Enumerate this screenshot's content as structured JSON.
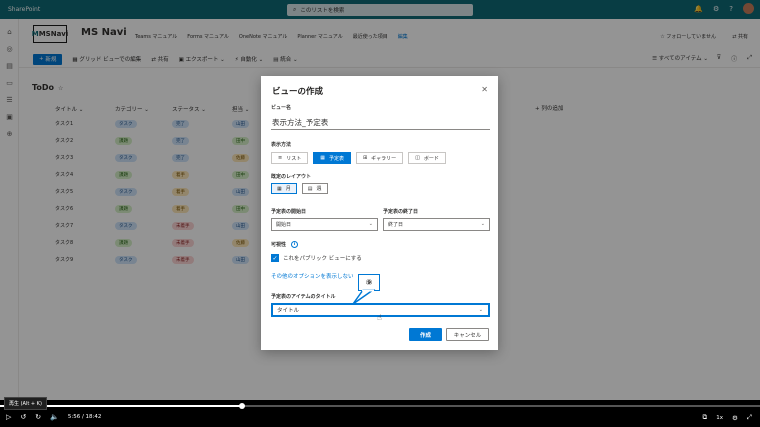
{
  "suite": {
    "app": "SharePoint",
    "search_placeholder": "このリストを検索"
  },
  "site": {
    "logo_text": "MSNavi",
    "name": "MS Navi",
    "nav": [
      "Teams マニュアル",
      "Forms マニュアル",
      "OneNote マニュアル",
      "Planner マニュアル",
      "最近使った項目",
      "編集"
    ],
    "follow": "フォローしていません",
    "share": "共有"
  },
  "commandbar": {
    "new": "新規",
    "grid_edit": "グリッド ビューでの編集",
    "share": "共有",
    "export": "エクスポート",
    "automate": "自動化",
    "integrate": "統合",
    "all_items": "すべてのアイテム"
  },
  "list": {
    "title": "ToDo",
    "columns": [
      "タイトル",
      "カテゴリー",
      "ステータス",
      "担当"
    ],
    "add_column": "列の追加",
    "rows": [
      {
        "title": "タスク1",
        "category": "タスク",
        "status": "完了",
        "owner": "山田"
      },
      {
        "title": "タスク2",
        "category": "課題",
        "status": "完了",
        "owner": "田中"
      },
      {
        "title": "タスク3",
        "category": "タスク",
        "status": "完了",
        "owner": "佐藤"
      },
      {
        "title": "タスク4",
        "category": "課題",
        "status": "着手",
        "owner": "田中"
      },
      {
        "title": "タスク5",
        "category": "タスク",
        "status": "着手",
        "owner": "山田"
      },
      {
        "title": "タスク6",
        "category": "課題",
        "status": "着手",
        "owner": "田中"
      },
      {
        "title": "タスク7",
        "category": "タスク",
        "status": "未着手",
        "owner": "山田"
      },
      {
        "title": "タスク8",
        "category": "課題",
        "status": "未着手",
        "owner": "佐藤"
      },
      {
        "title": "タスク9",
        "category": "タスク",
        "status": "未着手",
        "owner": "山田"
      }
    ]
  },
  "dialog": {
    "title": "ビューの作成",
    "view_name_label": "ビュー名",
    "view_name_value": "表示方法_予定表",
    "display_label": "表示方法",
    "display_options": [
      {
        "label": "リスト",
        "icon": "list-icon",
        "selected": false
      },
      {
        "label": "予定表",
        "icon": "calendar-icon",
        "selected": true
      },
      {
        "label": "ギャラリー",
        "icon": "gallery-icon",
        "selected": false
      },
      {
        "label": "ボード",
        "icon": "board-icon",
        "selected": false
      }
    ],
    "layout_label": "既定のレイアウト",
    "layout_options": [
      {
        "label": "月",
        "selected": true
      },
      {
        "label": "週",
        "selected": false
      }
    ],
    "start_label": "予定表の開始日",
    "start_value": "開始日",
    "end_label": "予定表の終了日",
    "end_value": "終了日",
    "visibility_label": "可視性",
    "public_checkbox": "これをパブリック ビューにする",
    "public_checked": true,
    "options_link": "その他のオプションを表示しない",
    "item_title_label": "予定表のアイテムのタイトル",
    "item_title_value": "タイトル",
    "callout": "⑨",
    "create": "作成",
    "cancel": "キャンセル"
  },
  "player": {
    "time": "5:56 / 18:42",
    "tooltip": "再生 (Alt + K)",
    "speed": "1x",
    "progress": 0.318
  },
  "colors": {
    "accent": "#0078d4",
    "suite": "#0f6a76"
  }
}
